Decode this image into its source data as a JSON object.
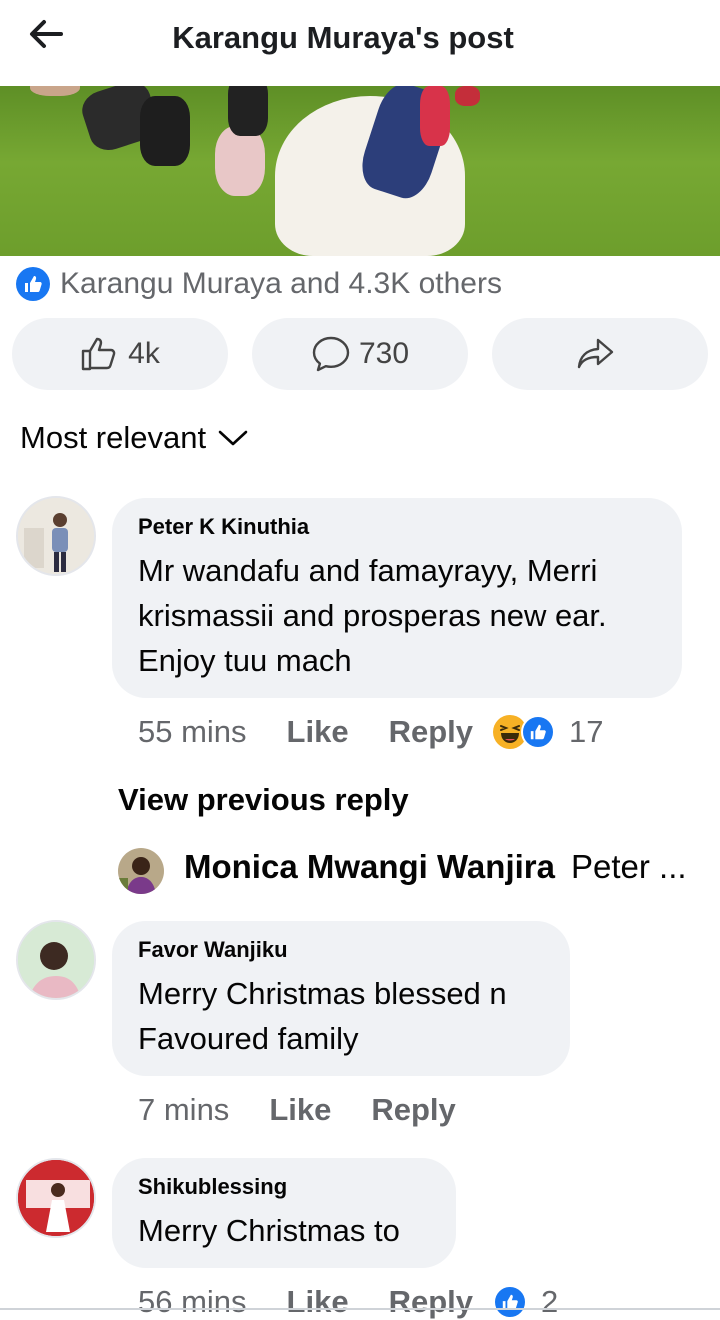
{
  "header": {
    "title": "Karangu Muraya's post"
  },
  "post": {
    "reactions_summary": "Karangu Muraya and 4.3K others",
    "actions": {
      "like_count": "4k",
      "comment_count": "730"
    }
  },
  "comments_sort": "Most relevant",
  "comments": [
    {
      "author": "Peter K Kinuthia",
      "line1": "Mr wandafu and famayrayy, Merri",
      "line2": "krismassii and prosperas new ear.",
      "line3": "Enjoy tuu mach",
      "time": "55 mins",
      "like_label": "Like",
      "reply_label": "Reply",
      "reaction_count": "17"
    },
    {
      "author": "Favor Wanjiku",
      "line1": "Merry Christmas blessed n",
      "line2": "Favoured family",
      "time": "7 mins",
      "like_label": "Like",
      "reply_label": "Reply"
    },
    {
      "author": "Shikublessing",
      "line1": "Merry Christmas to",
      "time": "56 mins",
      "like_label": "Like",
      "reply_label": "Reply",
      "reaction_count": "2"
    }
  ],
  "replies": {
    "view_previous": "View previous reply",
    "preview_author": "Monica Mwangi Wanjira",
    "preview_text": "Peter ..."
  },
  "colors": {
    "accent": "#1877f2",
    "bubble": "#f0f2f5",
    "muted": "#65676b"
  }
}
